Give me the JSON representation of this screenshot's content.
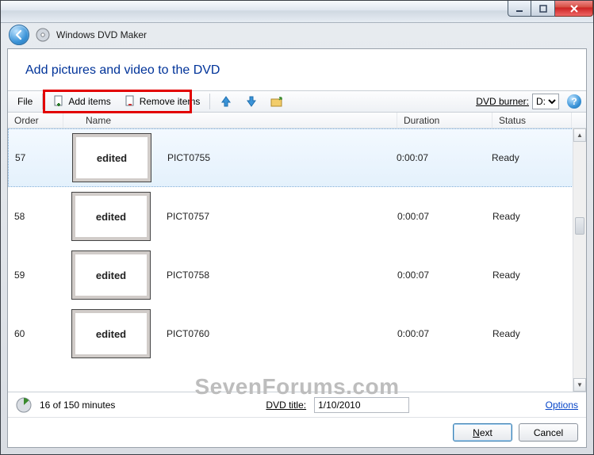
{
  "app": {
    "title": "Windows DVD Maker"
  },
  "heading": "Add pictures and video to the DVD",
  "toolbar": {
    "file_label": "File",
    "add_label": "Add items",
    "remove_label": "Remove items",
    "burner_label": "DVD burner:",
    "burner_value": "D:"
  },
  "columns": {
    "order": "Order",
    "name": "Name",
    "duration": "Duration",
    "status": "Status"
  },
  "thumb_label": "edited",
  "rows": [
    {
      "order": "57",
      "name": "PICT0755",
      "duration": "0:00:07",
      "status": "Ready",
      "selected": true
    },
    {
      "order": "58",
      "name": "PICT0757",
      "duration": "0:00:07",
      "status": "Ready",
      "selected": false
    },
    {
      "order": "59",
      "name": "PICT0758",
      "duration": "0:00:07",
      "status": "Ready",
      "selected": false
    },
    {
      "order": "60",
      "name": "PICT0760",
      "duration": "0:00:07",
      "status": "Ready",
      "selected": false
    }
  ],
  "footer": {
    "minutes_text": "16 of 150 minutes",
    "dvd_title_label": "DVD title:",
    "dvd_title_value": "1/10/2010",
    "options_label": "Options"
  },
  "buttons": {
    "next": "Next",
    "cancel": "Cancel"
  },
  "watermark": "SevenForums.com",
  "help_glyph": "?"
}
